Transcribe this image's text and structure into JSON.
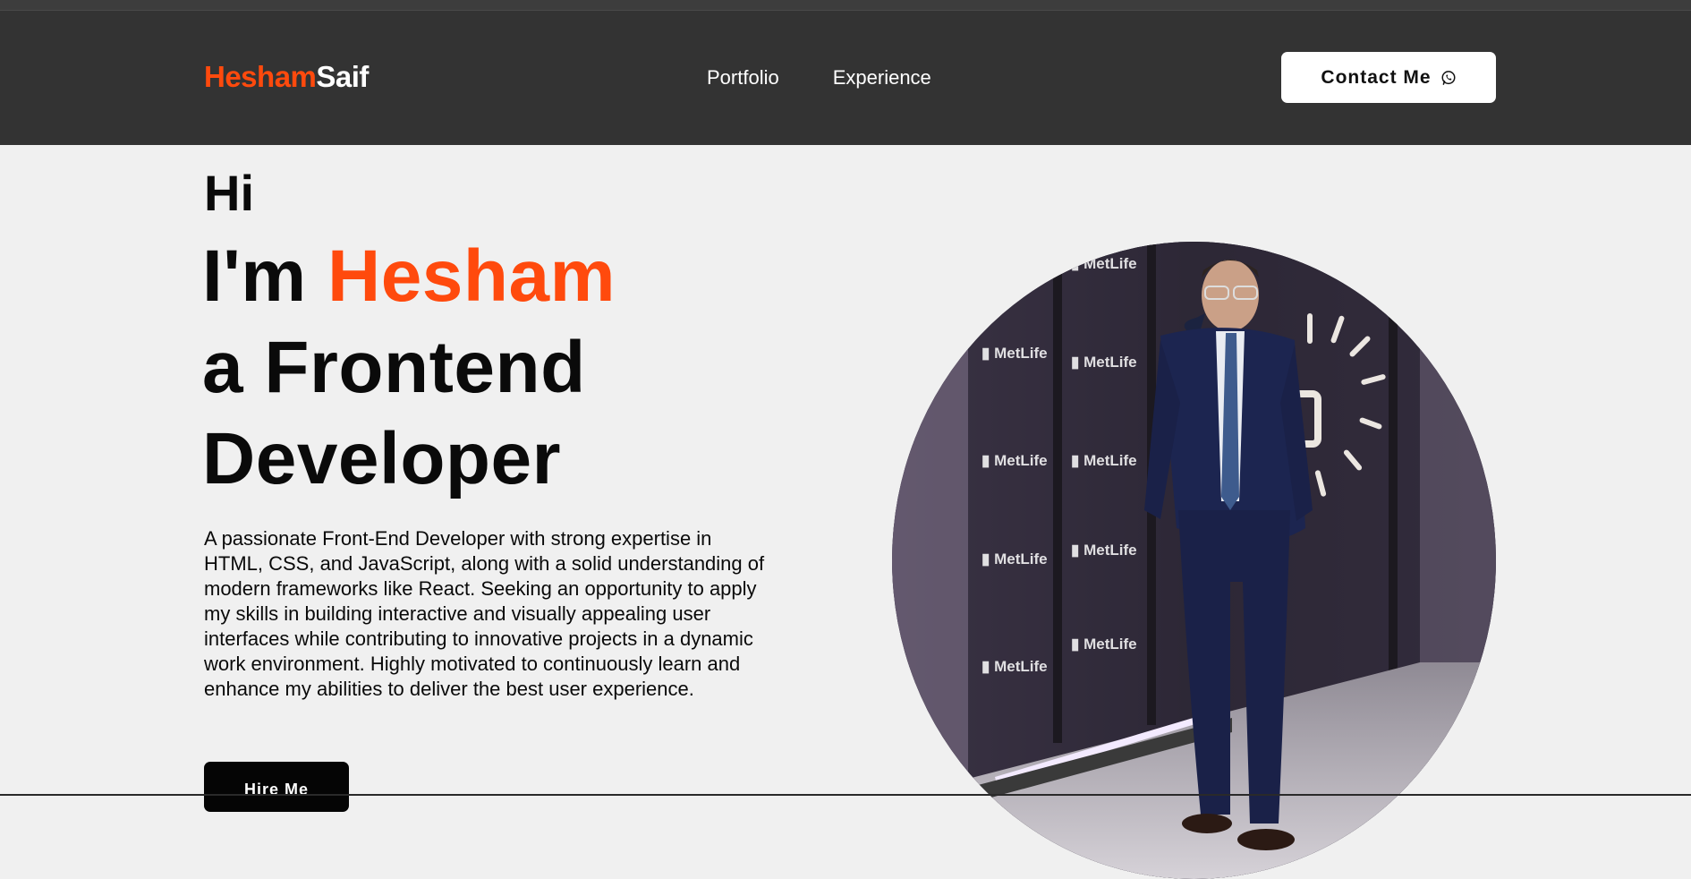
{
  "header": {
    "logo_first": "Hesham",
    "logo_second": "Saif",
    "nav": [
      {
        "label": "Portfolio"
      },
      {
        "label": "Experience"
      }
    ],
    "contact_label": "Contact Me",
    "contact_icon": "whatsapp-icon"
  },
  "hero": {
    "greeting": "Hi",
    "intro_prefix": "I'm ",
    "name": "Hesham",
    "role_line1": "a Frontend",
    "role_line2": "Developer",
    "description": "A passionate Front-End Developer with strong expertise in HTML, CSS, and JavaScript, along with a solid understanding of modern frameworks like React. Seeking an opportunity to apply my skills in building interactive and visually appealing user interfaces while contributing to innovative projects in a dynamic work environment. Highly motivated to continuously learn and enhance my abilities to deliver the best user experience.",
    "hire_label": "Hire Me",
    "photo_backdrop_text": "MetLife"
  },
  "colors": {
    "accent": "#ff4a0d",
    "navbar": "#333333",
    "background": "#f0f0f0",
    "text": "#0a0a0a"
  }
}
